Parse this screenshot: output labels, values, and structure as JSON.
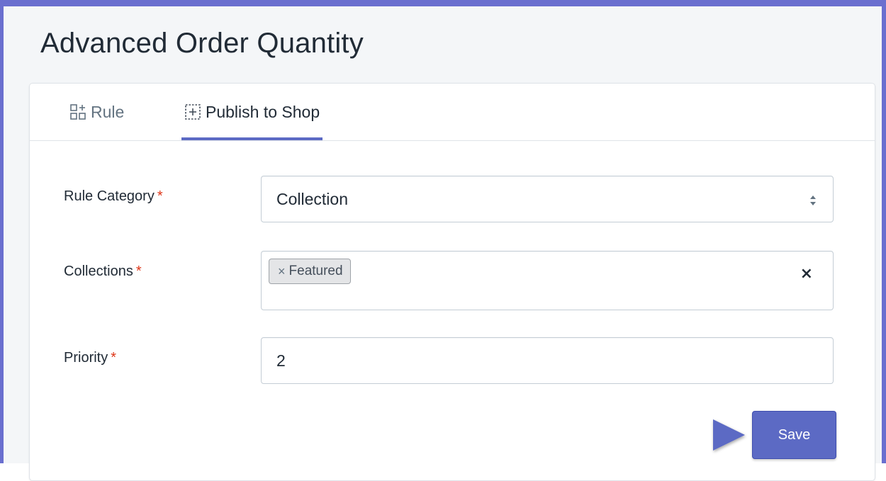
{
  "page": {
    "title": "Advanced Order Quantity"
  },
  "tabs": [
    {
      "label": "Rule",
      "icon": "rule-grid-icon",
      "active": false
    },
    {
      "label": "Publish to Shop",
      "icon": "publish-plus-icon",
      "active": true
    }
  ],
  "form": {
    "rule_category": {
      "label": "Rule Category",
      "required_marker": "*",
      "value": "Collection"
    },
    "collections": {
      "label": "Collections",
      "required_marker": "*",
      "tags": [
        {
          "remove_glyph": "×",
          "label": "Featured"
        }
      ],
      "clear_glyph": "×"
    },
    "priority": {
      "label": "Priority",
      "required_marker": "*",
      "value": "2"
    },
    "save_label": "Save"
  },
  "colors": {
    "accent": "#5c6ac4",
    "frame": "#6a6fcf",
    "required": "#de3618",
    "annotation_arrow": "#5c6ac4"
  }
}
